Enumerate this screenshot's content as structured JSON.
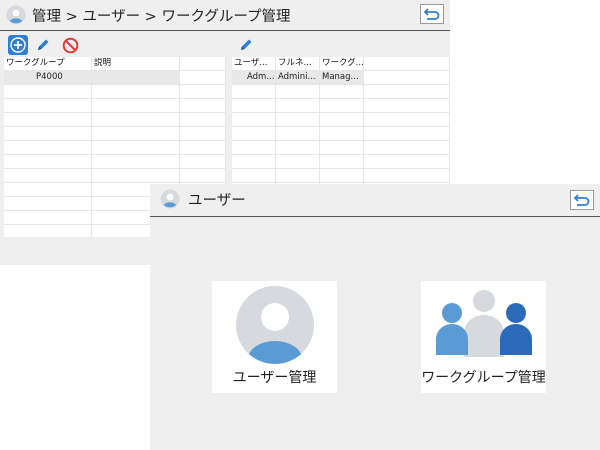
{
  "colors": {
    "accent_blue": "#2f7fd6",
    "avatar_blue": "#5b9bd5",
    "avatar_gray": "#d6d9de",
    "dark_blue": "#2a6ab8",
    "stop_red": "#e13b3b",
    "panel_bg": "#efefef"
  },
  "workgroup_screen": {
    "breadcrumb": "管理 > ユーザー > ワークグループ管理",
    "icons": {
      "title": "user-avatar-icon",
      "back": "back-arrow-icon",
      "add": "add-icon",
      "edit": "pencil-icon",
      "delete": "prohibit-icon",
      "edit_users": "pencil-icon"
    },
    "workgroup_table": {
      "columns": [
        "ワークグループ",
        "説明"
      ],
      "rows": [
        [
          "P4000",
          ""
        ]
      ]
    },
    "user_table": {
      "columns": [
        "ユーザ...",
        "フルネ...",
        "ワークグ..."
      ],
      "rows": [
        [
          "Adm...",
          "Admini...",
          "Manag..."
        ]
      ]
    }
  },
  "user_screen": {
    "title": "ユーザー",
    "icons": {
      "title": "user-avatar-icon",
      "back": "back-arrow-icon"
    },
    "cards": [
      {
        "label": "ユーザー管理",
        "icon": "user-avatar-icon"
      },
      {
        "label": "ワークグループ管理",
        "icon": "group-icon"
      }
    ]
  }
}
